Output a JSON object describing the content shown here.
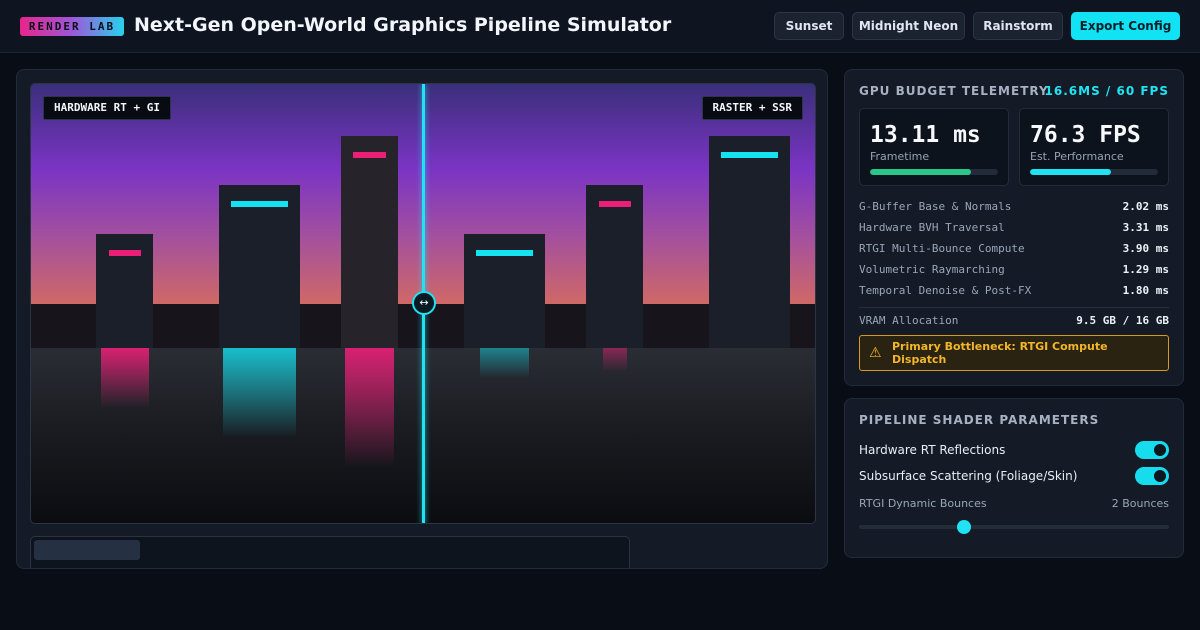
{
  "header": {
    "logo": "RENDER LAB",
    "title": "Next-Gen Open-World Graphics Pipeline Simulator",
    "presets": [
      "Sunset",
      "Midnight Neon",
      "Rainstorm"
    ],
    "export_label": "Export Config"
  },
  "viewport": {
    "left_label": "HARDWARE RT + GI",
    "right_label": "RASTER + SSR",
    "split_handle_glyph": "↔",
    "split_fraction": 0.5
  },
  "telemetry": {
    "title": "GPU BUDGET TELEMETRY",
    "budget": "16.6MS / 60 FPS",
    "frametime": {
      "value": "13.11 ms",
      "label": "Frametime",
      "fill": 0.79,
      "color": "#2ac78a"
    },
    "fps": {
      "value": "76.3 FPS",
      "label": "Est. Performance",
      "fill": 0.63,
      "color": "#1fe3f2"
    },
    "passes": [
      {
        "name": "G-Buffer Base & Normals",
        "value": "2.02 ms"
      },
      {
        "name": "Hardware BVH Traversal",
        "value": "3.31 ms"
      },
      {
        "name": "RTGI Multi-Bounce Compute",
        "value": "3.90 ms"
      },
      {
        "name": "Volumetric Raymarching",
        "value": "1.29 ms"
      },
      {
        "name": "Temporal Denoise & Post-FX",
        "value": "1.80 ms"
      }
    ],
    "vram": {
      "label": "VRAM Allocation",
      "value": "9.5 GB / 16 GB"
    },
    "warning": {
      "icon": "warning-icon",
      "text": "Primary Bottleneck: RTGI Compute Dispatch"
    }
  },
  "shader": {
    "title": "PIPELINE SHADER PARAMETERS",
    "toggles": [
      {
        "label": "Hardware RT Reflections",
        "on": true
      },
      {
        "label": "Subsurface Scattering (Foliage/Skin)",
        "on": true
      }
    ],
    "slider": {
      "label": "RTGI Dynamic Bounces",
      "value_text": "2 Bounces",
      "fraction": 0.34
    }
  },
  "colors": {
    "accent": "#1fe3f2",
    "magenta": "#ec1f78",
    "warning": "#f2b62a"
  }
}
